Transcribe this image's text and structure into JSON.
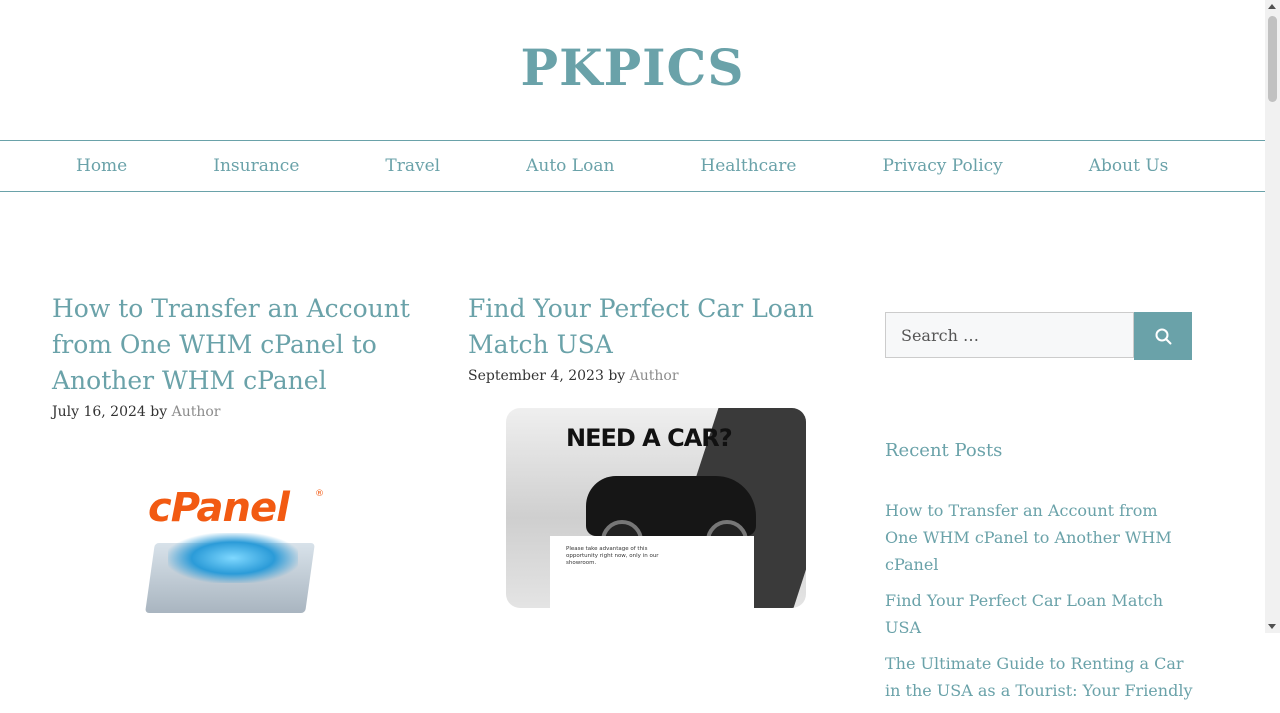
{
  "site": {
    "title": "PKPICS"
  },
  "nav": {
    "items": [
      {
        "label": "Home"
      },
      {
        "label": "Insurance"
      },
      {
        "label": "Travel"
      },
      {
        "label": "Auto Loan"
      },
      {
        "label": "Healthcare"
      },
      {
        "label": "Privacy Policy"
      },
      {
        "label": "About Us"
      }
    ]
  },
  "posts": [
    {
      "title": "How to Transfer an Account from One WHM cPanel to Another WHM cPanel",
      "date": "July 16, 2024",
      "by": "by",
      "author": "Author",
      "image": {
        "logo_text": "cPanel",
        "reg": "®"
      }
    },
    {
      "title": "Find Your Perfect Car Loan Match USA",
      "date": "September 4, 2023",
      "by": "by",
      "author": "Author",
      "image": {
        "headline": "NEED A CAR?",
        "fine_print": "Please take advantage of this opportunity right now, only in our showroom."
      }
    }
  ],
  "sidebar": {
    "search": {
      "placeholder": "Search …",
      "icon": "search-icon"
    },
    "recent_heading": "Recent Posts",
    "recent_posts": [
      {
        "title": "How to Transfer an Account from One WHM cPanel to Another WHM cPanel"
      },
      {
        "title": "Find Your Perfect Car Loan Match USA"
      },
      {
        "title": "The Ultimate Guide to Renting a Car in the USA as a Tourist: Your Friendly"
      }
    ]
  },
  "colors": {
    "accent": "#6aa2a9",
    "text": "#333333",
    "meta_author": "#8c8c8c"
  }
}
